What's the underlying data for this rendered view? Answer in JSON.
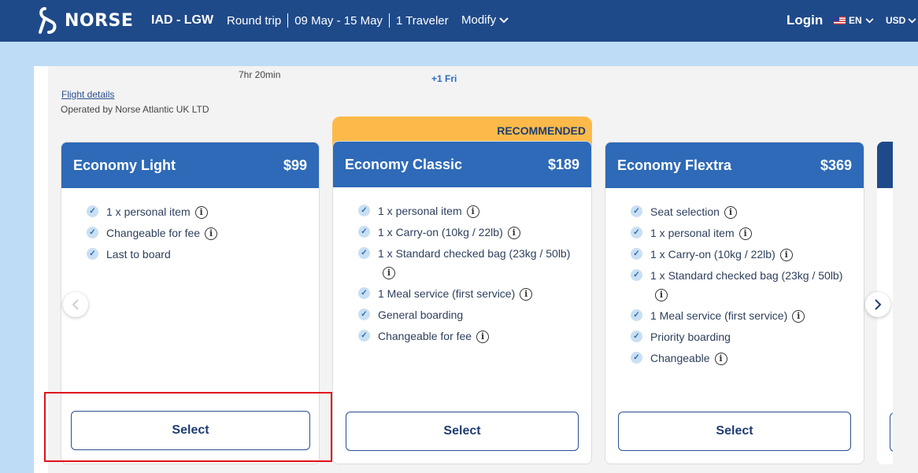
{
  "header": {
    "brand": "NORSE",
    "route": "IAD - LGW",
    "trip_type": "Round trip",
    "dates": "09 May - 15 May",
    "travelers": "1 Traveler",
    "modify": "Modify",
    "login": "Login",
    "language": "EN",
    "currency": "USD"
  },
  "flight": {
    "duration": "7hr 20min",
    "arrival_note": "+1 Fri",
    "details_link": "Flight details",
    "operated_by": "Operated by Norse Atlantic UK LTD"
  },
  "recommended_label": "RECOMMENDED",
  "fares": [
    {
      "name": "Economy Light",
      "price": "$99",
      "features": [
        {
          "text": "1 x personal item",
          "info": true
        },
        {
          "text": "Changeable for fee",
          "info": true
        },
        {
          "text": "Last to board",
          "info": false
        }
      ],
      "select_label": "Select"
    },
    {
      "name": "Economy Classic",
      "price": "$189",
      "features": [
        {
          "text": "1 x personal item",
          "info": true
        },
        {
          "text": "1 x Carry-on (10kg / 22lb)",
          "info": true
        },
        {
          "text": "1 x Standard checked bag (23kg / 50lb)",
          "info": true
        },
        {
          "text": "1 Meal service (first service)",
          "info": true
        },
        {
          "text": "General boarding",
          "info": false
        },
        {
          "text": "Changeable for fee",
          "info": true
        }
      ],
      "select_label": "Select"
    },
    {
      "name": "Economy Flextra",
      "price": "$369",
      "features": [
        {
          "text": "Seat selection",
          "info": true
        },
        {
          "text": "1 x personal item",
          "info": true
        },
        {
          "text": "1 x Carry-on (10kg / 22lb)",
          "info": true
        },
        {
          "text": "1 x Standard checked bag (23kg / 50lb)",
          "info": true
        },
        {
          "text": "1 Meal service (first service)",
          "info": true
        },
        {
          "text": "Priority boarding",
          "info": false
        },
        {
          "text": "Changeable",
          "info": true
        }
      ],
      "select_label": "Select"
    }
  ],
  "icons": {
    "check": "check-icon",
    "info": "info-icon",
    "prev": "chevron-left-icon",
    "next": "chevron-right-icon"
  },
  "colors": {
    "header_bg": "#1f4a8a",
    "card_header": "#2e6ab8",
    "recommended": "#fdba4a",
    "highlight": "#e0121b"
  }
}
